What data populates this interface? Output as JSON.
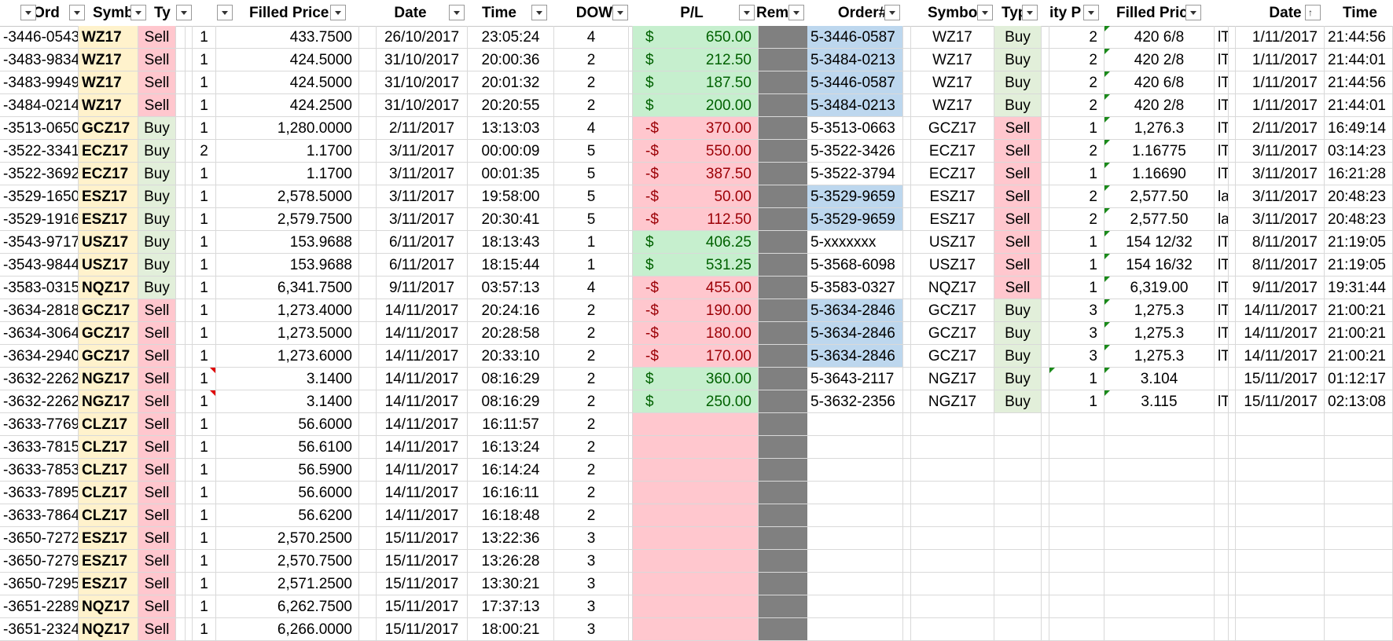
{
  "headers": {
    "ord": "Ord",
    "symb": "Symb",
    "ty": "Ty",
    "filled_price": "Filled Price",
    "date": "Date",
    "time": "Time",
    "dow": "DOW",
    "pl": "P/L",
    "rem": "Rem",
    "order_num": "Order#",
    "symbo": "Symbo",
    "typ": "Typ",
    "qty_p": "ity P",
    "filled_pric": "Filled Pric",
    "date2": "Date",
    "time2": "Time"
  },
  "rows": [
    {
      "ord": "-3446-0543",
      "sym": "WZ17",
      "type": "Sell",
      "qty": "1",
      "price": "433.7500",
      "date": "26/10/2017",
      "time": "23:05:24",
      "dow": "4",
      "pl": "650.00",
      "pl_sign": "$",
      "pl_kind": "pos",
      "order": "5-3446-0587",
      "order_hl": true,
      "sym2": "WZ17",
      "type2": "Buy",
      "qty2": "2",
      "price2": "420 6/8",
      "f2": "lT",
      "date2": "1/11/2017",
      "time2": "21:44:56"
    },
    {
      "ord": "-3483-9834",
      "sym": "WZ17",
      "type": "Sell",
      "qty": "1",
      "price": "424.5000",
      "date": "31/10/2017",
      "time": "20:00:36",
      "dow": "2",
      "pl": "212.50",
      "pl_sign": "$",
      "pl_kind": "pos",
      "order": "5-3484-0213",
      "order_hl": true,
      "sym2": "WZ17",
      "type2": "Buy",
      "qty2": "2",
      "price2": "420 2/8",
      "f2": "lT",
      "date2": "1/11/2017",
      "time2": "21:44:01"
    },
    {
      "ord": "-3483-9949",
      "sym": "WZ17",
      "type": "Sell",
      "qty": "1",
      "price": "424.5000",
      "date": "31/10/2017",
      "time": "20:01:32",
      "dow": "2",
      "pl": "187.50",
      "pl_sign": "$",
      "pl_kind": "pos",
      "order": "5-3446-0587",
      "order_hl": true,
      "sym2": "WZ17",
      "type2": "Buy",
      "qty2": "2",
      "price2": "420 6/8",
      "f2": "lT",
      "date2": "1/11/2017",
      "time2": "21:44:56"
    },
    {
      "ord": "-3484-0214",
      "sym": "WZ17",
      "type": "Sell",
      "qty": "1",
      "price": "424.2500",
      "date": "31/10/2017",
      "time": "20:20:55",
      "dow": "2",
      "pl": "200.00",
      "pl_sign": "$",
      "pl_kind": "pos",
      "order": "5-3484-0213",
      "order_hl": true,
      "sym2": "WZ17",
      "type2": "Buy",
      "qty2": "2",
      "price2": "420 2/8",
      "f2": "lT",
      "date2": "1/11/2017",
      "time2": "21:44:01"
    },
    {
      "ord": "-3513-0650",
      "sym": "GCZ17",
      "type": "Buy",
      "qty": "1",
      "price": "1,280.0000",
      "date": "2/11/2017",
      "time": "13:13:03",
      "dow": "4",
      "pl": "370.00",
      "pl_sign": "-$",
      "pl_kind": "neg",
      "order": "5-3513-0663",
      "order_hl": false,
      "sym2": "GCZ17",
      "type2": "Sell",
      "qty2": "1",
      "price2": "1,276.3",
      "f2": "lT",
      "date2": "2/11/2017",
      "time2": "16:49:14"
    },
    {
      "ord": "-3522-3341",
      "sym": "ECZ17",
      "type": "Buy",
      "qty": "2",
      "price": "1.1700",
      "date": "3/11/2017",
      "time": "00:00:09",
      "dow": "5",
      "pl": "550.00",
      "pl_sign": "-$",
      "pl_kind": "neg",
      "order": "5-3522-3426",
      "order_hl": false,
      "sym2": "ECZ17",
      "type2": "Sell",
      "qty2": "2",
      "price2": "1.16775",
      "f2": "lT",
      "date2": "3/11/2017",
      "time2": "03:14:23"
    },
    {
      "ord": "-3522-3692",
      "sym": "ECZ17",
      "type": "Buy",
      "qty": "1",
      "price": "1.1700",
      "date": "3/11/2017",
      "time": "00:01:35",
      "dow": "5",
      "pl": "387.50",
      "pl_sign": "-$",
      "pl_kind": "neg",
      "order": "5-3522-3794",
      "order_hl": false,
      "sym2": "ECZ17",
      "type2": "Sell",
      "qty2": "1",
      "price2": "1.16690",
      "f2": "lT",
      "date2": "3/11/2017",
      "time2": "16:21:28"
    },
    {
      "ord": "-3529-1650",
      "sym": "ESZ17",
      "type": "Buy",
      "qty": "1",
      "price": "2,578.5000",
      "date": "3/11/2017",
      "time": "19:58:00",
      "dow": "5",
      "pl": "50.00",
      "pl_sign": "-$",
      "pl_kind": "neg",
      "order": "5-3529-9659",
      "order_hl": true,
      "sym2": "ESZ17",
      "type2": "Sell",
      "qty2": "2",
      "price2": "2,577.50",
      "f2": "la",
      "date2": "3/11/2017",
      "time2": "20:48:23"
    },
    {
      "ord": "-3529-1916",
      "sym": "ESZ17",
      "type": "Buy",
      "qty": "1",
      "price": "2,579.7500",
      "date": "3/11/2017",
      "time": "20:30:41",
      "dow": "5",
      "pl": "112.50",
      "pl_sign": "-$",
      "pl_kind": "neg",
      "order": "5-3529-9659",
      "order_hl": true,
      "sym2": "ESZ17",
      "type2": "Sell",
      "qty2": "2",
      "price2": "2,577.50",
      "f2": "la",
      "date2": "3/11/2017",
      "time2": "20:48:23"
    },
    {
      "ord": "-3543-9717",
      "sym": "USZ17",
      "type": "Buy",
      "qty": "1",
      "price": "153.9688",
      "date": "6/11/2017",
      "time": "18:13:43",
      "dow": "1",
      "pl": "406.25",
      "pl_sign": "$",
      "pl_kind": "pos",
      "order": "5-xxxxxxx",
      "order_hl": false,
      "sym2": "USZ17",
      "type2": "Sell",
      "qty2": "1",
      "price2": "154 12/32",
      "f2": "lT",
      "date2": "8/11/2017",
      "time2": "21:19:05"
    },
    {
      "ord": "-3543-9844",
      "sym": "USZ17",
      "type": "Buy",
      "qty": "1",
      "price": "153.9688",
      "date": "6/11/2017",
      "time": "18:15:44",
      "dow": "1",
      "pl": "531.25",
      "pl_sign": "$",
      "pl_kind": "pos",
      "order": "5-3568-6098",
      "order_hl": false,
      "sym2": "USZ17",
      "type2": "Sell",
      "qty2": "1",
      "price2": "154 16/32",
      "f2": "lT",
      "date2": "8/11/2017",
      "time2": "21:19:05"
    },
    {
      "ord": "-3583-0315",
      "sym": "NQZ17",
      "type": "Buy",
      "qty": "1",
      "price": "6,341.7500",
      "date": "9/11/2017",
      "time": "03:57:13",
      "dow": "4",
      "pl": "455.00",
      "pl_sign": "-$",
      "pl_kind": "neg",
      "order": "5-3583-0327",
      "order_hl": false,
      "sym2": "NQZ17",
      "type2": "Sell",
      "qty2": "1",
      "price2": "6,319.00",
      "f2": "lT",
      "date2": "9/11/2017",
      "time2": "19:31:44"
    },
    {
      "ord": "-3634-2818",
      "sym": "GCZ17",
      "type": "Sell",
      "qty": "1",
      "price": "1,273.4000",
      "date": "14/11/2017",
      "time": "20:24:16",
      "dow": "2",
      "pl": "190.00",
      "pl_sign": "-$",
      "pl_kind": "neg",
      "order": "5-3634-2846",
      "order_hl": true,
      "sym2": "GCZ17",
      "type2": "Buy",
      "qty2": "3",
      "price2": "1,275.3",
      "f2": "lT",
      "date2": "14/11/2017",
      "time2": "21:00:21"
    },
    {
      "ord": "-3634-3064",
      "sym": "GCZ17",
      "type": "Sell",
      "qty": "1",
      "price": "1,273.5000",
      "date": "14/11/2017",
      "time": "20:28:58",
      "dow": "2",
      "pl": "180.00",
      "pl_sign": "-$",
      "pl_kind": "neg",
      "order": "5-3634-2846",
      "order_hl": true,
      "sym2": "GCZ17",
      "type2": "Buy",
      "qty2": "3",
      "price2": "1,275.3",
      "f2": "lT",
      "date2": "14/11/2017",
      "time2": "21:00:21"
    },
    {
      "ord": "-3634-2940",
      "sym": "GCZ17",
      "type": "Sell",
      "qty": "1",
      "price": "1,273.6000",
      "date": "14/11/2017",
      "time": "20:33:10",
      "dow": "2",
      "pl": "170.00",
      "pl_sign": "-$",
      "pl_kind": "neg",
      "order": "5-3634-2846",
      "order_hl": true,
      "sym2": "GCZ17",
      "type2": "Buy",
      "qty2": "3",
      "price2": "1,275.3",
      "f2": "lT",
      "date2": "14/11/2017",
      "time2": "21:00:21"
    },
    {
      "ord": "-3632-2262",
      "sym": "NGZ17",
      "type": "Sell",
      "qty": "1",
      "price": "3.1400",
      "date": "14/11/2017",
      "time": "08:16:29",
      "dow": "2",
      "pl": "360.00",
      "pl_sign": "$",
      "pl_kind": "pos",
      "order": "5-3643-2117",
      "order_hl": false,
      "sym2": "NGZ17",
      "type2": "Buy",
      "qty2": "1",
      "price2": "3.104",
      "f2": "",
      "date2": "15/11/2017",
      "time2": "01:12:17",
      "ord_hl": true,
      "note": true
    },
    {
      "ord": "-3632-2262",
      "sym": "NGZ17",
      "type": "Sell",
      "qty": "1",
      "price": "3.1400",
      "date": "14/11/2017",
      "time": "08:16:29",
      "dow": "2",
      "pl": "250.00",
      "pl_sign": "$",
      "pl_kind": "pos",
      "order": "5-3632-2356",
      "order_hl": false,
      "sym2": "NGZ17",
      "type2": "Buy",
      "qty2": "1",
      "price2": "3.115",
      "f2": "lT",
      "date2": "15/11/2017",
      "time2": "02:13:08",
      "ord_hl": true,
      "note": true
    },
    {
      "ord": "-3633-7769",
      "sym": "CLZ17",
      "type": "Sell",
      "qty": "1",
      "price": "56.6000",
      "date": "14/11/2017",
      "time": "16:11:57",
      "dow": "2",
      "pl": "",
      "pl_sign": "",
      "pl_kind": "neg"
    },
    {
      "ord": "-3633-7815",
      "sym": "CLZ17",
      "type": "Sell",
      "qty": "1",
      "price": "56.6100",
      "date": "14/11/2017",
      "time": "16:13:24",
      "dow": "2",
      "pl": "",
      "pl_sign": "",
      "pl_kind": "neg"
    },
    {
      "ord": "-3633-7853",
      "sym": "CLZ17",
      "type": "Sell",
      "qty": "1",
      "price": "56.5900",
      "date": "14/11/2017",
      "time": "16:14:24",
      "dow": "2",
      "pl": "",
      "pl_sign": "",
      "pl_kind": "neg"
    },
    {
      "ord": "-3633-7895",
      "sym": "CLZ17",
      "type": "Sell",
      "qty": "1",
      "price": "56.6000",
      "date": "14/11/2017",
      "time": "16:16:11",
      "dow": "2",
      "pl": "",
      "pl_sign": "",
      "pl_kind": "neg"
    },
    {
      "ord": "-3633-7864",
      "sym": "CLZ17",
      "type": "Sell",
      "qty": "1",
      "price": "56.6200",
      "date": "14/11/2017",
      "time": "16:18:48",
      "dow": "2",
      "pl": "",
      "pl_sign": "",
      "pl_kind": "neg"
    },
    {
      "ord": "-3650-7272",
      "sym": "ESZ17",
      "type": "Sell",
      "qty": "1",
      "price": "2,570.2500",
      "date": "15/11/2017",
      "time": "13:22:36",
      "dow": "3",
      "pl": "",
      "pl_sign": "",
      "pl_kind": "neg"
    },
    {
      "ord": "-3650-7279",
      "sym": "ESZ17",
      "type": "Sell",
      "qty": "1",
      "price": "2,570.7500",
      "date": "15/11/2017",
      "time": "13:26:28",
      "dow": "3",
      "pl": "",
      "pl_sign": "",
      "pl_kind": "neg"
    },
    {
      "ord": "-3650-7295",
      "sym": "ESZ17",
      "type": "Sell",
      "qty": "1",
      "price": "2,571.2500",
      "date": "15/11/2017",
      "time": "13:30:21",
      "dow": "3",
      "pl": "",
      "pl_sign": "",
      "pl_kind": "neg"
    },
    {
      "ord": "-3651-2289",
      "sym": "NQZ17",
      "type": "Sell",
      "qty": "1",
      "price": "6,262.7500",
      "date": "15/11/2017",
      "time": "17:37:13",
      "dow": "3",
      "pl": "",
      "pl_sign": "",
      "pl_kind": "neg"
    },
    {
      "ord": "-3651-2324",
      "sym": "NQZ17",
      "type": "Sell",
      "qty": "1",
      "price": "6,266.0000",
      "date": "15/11/2017",
      "time": "18:00:21",
      "dow": "3",
      "pl": "",
      "pl_sign": "",
      "pl_kind": "neg"
    }
  ]
}
